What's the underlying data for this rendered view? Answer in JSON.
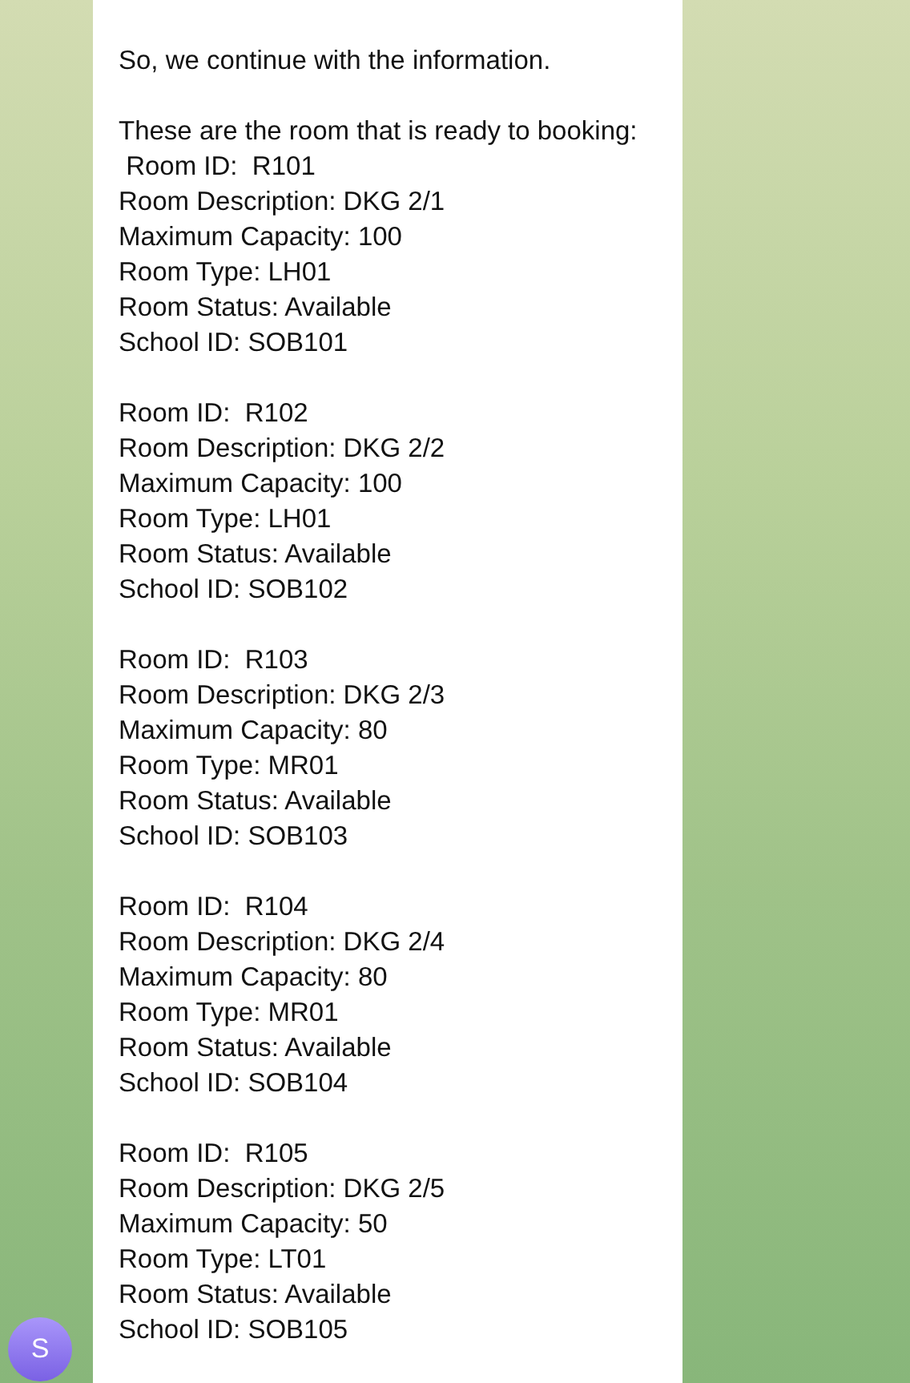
{
  "message": {
    "paragraphs": [
      [
        "So, we continue with the information."
      ],
      [
        "These are the room that is ready to booking:",
        " Room ID:  R101",
        "Room Description: DKG 2/1",
        "Maximum Capacity: 100",
        "Room Type: LH01",
        "Room Status: Available",
        "School ID: SOB101"
      ],
      [
        "Room ID:  R102",
        "Room Description: DKG 2/2",
        "Maximum Capacity: 100",
        "Room Type: LH01",
        "Room Status: Available",
        "School ID: SOB102"
      ],
      [
        "Room ID:  R103",
        "Room Description: DKG 2/3",
        "Maximum Capacity: 80",
        "Room Type: MR01",
        "Room Status: Available",
        "School ID: SOB103"
      ],
      [
        "Room ID:  R104",
        "Room Description: DKG 2/4",
        "Maximum Capacity: 80",
        "Room Type: MR01",
        "Room Status: Available",
        "School ID: SOB104"
      ],
      [
        "Room ID:  R105",
        "Room Description: DKG 2/5",
        "Maximum Capacity: 50",
        "Room Type: LT01",
        "Room Status: Available",
        "School ID: SOB105"
      ]
    ]
  },
  "sender": {
    "initial": "S"
  }
}
